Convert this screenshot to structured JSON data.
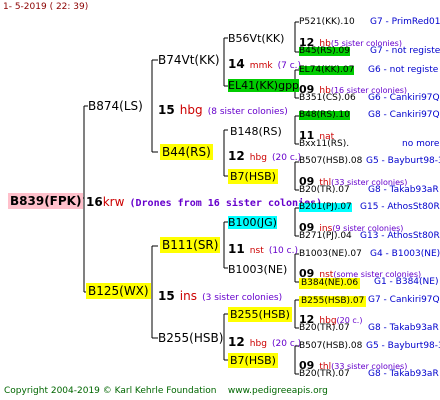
{
  "header": {
    "date": "1-   5-2019 (  22:  39)"
  },
  "root": {
    "name": "B839(FPK)",
    "num": "16",
    "breed": "krw",
    "note": "(Drones from 16 sister colonies)"
  },
  "gen1": [
    {
      "name": "B874(LS)",
      "num": "15",
      "breed": "hbg",
      "note": "(8 sister colonies)"
    },
    {
      "name": "B125(WX)",
      "num": "15",
      "breed": "ins",
      "note": "(3 sister colonies)"
    }
  ],
  "gen2": [
    {
      "name": "B74Vt(KK)",
      "num": "14",
      "breed": "mmk",
      "note": "(7 c.)"
    },
    {
      "name": "B44(RS)",
      "num": "12",
      "breed": "hbg",
      "note": "(20 c.)"
    },
    {
      "name": "B111(SR)",
      "num": "11",
      "breed": "nst",
      "note": "(10 c.)"
    },
    {
      "name": "B255(HSB)",
      "num": "12",
      "breed": "hbg",
      "note": "(20 c.)"
    }
  ],
  "gen3": [
    {
      "name": "B56Vt(KK)",
      "num": "12",
      "breed": "hb",
      "note": "(5 sister colonies)"
    },
    {
      "name": "EL41(KK)gpp",
      "num": "09",
      "breed": "hb",
      "note": "(16 sister colonies)"
    },
    {
      "name": "B148(RS)",
      "num": "11",
      "breed": "nat",
      "note": ""
    },
    {
      "name": "B7(HSB)",
      "num": "09",
      "breed": "thl",
      "note": "(33 sister colonies)"
    },
    {
      "name": "B100(JG)",
      "num": "09",
      "breed": "ins",
      "note": "(9 sister colonies)"
    },
    {
      "name": "B1003(NE)",
      "num": "09",
      "breed": "nst",
      "note": "(some sister colonies)"
    },
    {
      "name": "B255(HSB)",
      "num": "12",
      "breed": "hbg",
      "note": "(20 c.)"
    },
    {
      "name": "B7(HSB)",
      "num": "09",
      "breed": "thl",
      "note": "(33 sister colonies)"
    }
  ],
  "gen4": [
    {
      "name": "P521(KK).10",
      "right": "G7 - PrimRed01"
    },
    {
      "name": "B45(RS).09",
      "right": "G7 - not registe"
    },
    {
      "name": "EL74(KK).07",
      "right": "G6 - not registe"
    },
    {
      "name": "B351(CS).06",
      "right": "G6 - Cankiri97Q"
    },
    {
      "name": "B48(RS).10",
      "right": "G8 - Cankiri97Q"
    },
    {
      "name": "Bxx11(RS).",
      "right": "no more"
    },
    {
      "name": "B507(HSB).08",
      "right": "G5 - Bayburt98-3"
    },
    {
      "name": "B20(TR).07",
      "right": "G8 - Takab93aR"
    },
    {
      "name": "B201(PJ).07",
      "right": "G15 - AthosSt80R"
    },
    {
      "name": "B271(PJ).04",
      "right": "G13 - AthosSt80R"
    },
    {
      "name": "B1003(NE).07",
      "right": "G4 - B1003(NE)"
    },
    {
      "name": "B384(NE).06",
      "right": "G1 - B384(NE)"
    },
    {
      "name": "B255(HSB).07",
      "right": "G7 - Cankiri97Q"
    },
    {
      "name": "B20(TR).07",
      "right": "G8 - Takab93aR"
    },
    {
      "name": "B507(HSB).08",
      "right": "G5 - Bayburt98-3"
    },
    {
      "name": "B20(TR).07",
      "right": "G8 - Takab93aR"
    }
  ],
  "footer": {
    "copyright": "Copyright 2004-2019 © Karl Kehrle Foundation",
    "url": "www.pedigreeapis.org"
  }
}
